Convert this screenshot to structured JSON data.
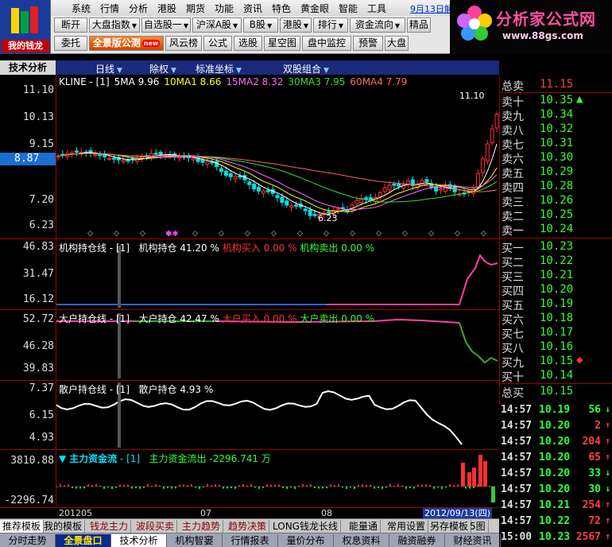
{
  "app": {
    "logo_text": "我的钱龙",
    "brand_title": "分析家公式网",
    "brand_url": "www.88gs.com"
  },
  "menu": [
    "系统",
    "行情",
    "分析",
    "港股",
    "期货",
    "功能",
    "资讯",
    "特色",
    "黄金眼",
    "智能",
    "工具"
  ],
  "menu_date": "9月13日解",
  "toolbar": {
    "row1": [
      {
        "label": "断开",
        "dd": false
      },
      {
        "label": "大盘指数",
        "dd": true
      },
      {
        "label": "自选股一",
        "dd": true
      },
      {
        "label": "沪深A股",
        "dd": true
      },
      {
        "label": "B股",
        "dd": true
      },
      {
        "label": "港股",
        "dd": true
      },
      {
        "label": "排行",
        "dd": true
      },
      {
        "label": "资金流向",
        "dd": true
      },
      {
        "label": "精品",
        "dd": false
      }
    ],
    "row2": [
      {
        "label": "委托",
        "dd": false
      },
      {
        "label": "全景版公测",
        "dd": false,
        "badge": "new"
      },
      {
        "label": "风云榜",
        "dd": false
      },
      {
        "label": "公式",
        "dd": false
      },
      {
        "label": "选股",
        "dd": false
      },
      {
        "label": "星空图",
        "dd": false
      },
      {
        "label": "盘中监控",
        "dd": false
      },
      {
        "label": "预警",
        "dd": false
      },
      {
        "label": "大盘",
        "dd": false
      }
    ]
  },
  "header": {
    "tab": "技术分析",
    "selectors": [
      "日线",
      "除权",
      "标准坐标",
      "双股组合"
    ]
  },
  "kline": {
    "legend_name": "KLINE",
    "legend_period": "[1]",
    "ma": [
      {
        "label": "5MA",
        "value": "9.96",
        "color": "#ffffff"
      },
      {
        "label": "10MA1",
        "value": "8.66",
        "color": "#ffff00"
      },
      {
        "label": "15MA2",
        "value": "8.32",
        "color": "#ff66ff"
      },
      {
        "label": "30MA3",
        "value": "7.95",
        "color": "#33dd33"
      },
      {
        "label": "60MA4",
        "value": "7.79",
        "color": "#ff6666"
      }
    ],
    "y_labels": [
      "11.10",
      "10.13",
      "9.15",
      "7.20",
      "6.23"
    ],
    "current_price": "8.87",
    "high_label": "11.10",
    "low_label": "6.23"
  },
  "inst": {
    "name": "机构持仓线",
    "period": "[1]",
    "hold_label": "机构持仓",
    "hold": "41.20 %",
    "buy_label": "机构买入",
    "buy": "0.00 %",
    "sell_label": "机构卖出",
    "sell": "0.00 %",
    "y_labels": [
      "46.83",
      "31.47",
      "16.12"
    ]
  },
  "big": {
    "name": "大户持仓线",
    "period": "[1]",
    "hold_label": "大户持仓",
    "hold": "42.47 %",
    "buy_label": "大户买入",
    "buy": "0.00 %",
    "sell_label": "大户卖出",
    "sell": "0.00 %",
    "y_labels": [
      "52.72",
      "46.28",
      "39.83"
    ]
  },
  "retail": {
    "name": "散户持仓线",
    "period": "[1]",
    "hold_label": "散户持仓",
    "hold": "4.93 %",
    "y_labels": [
      "7.37",
      "6.15",
      "4.93"
    ]
  },
  "flow": {
    "name": "主力资金流",
    "period": "[1]",
    "label": "主力资金流出",
    "value": "-2296.741 万",
    "y_labels": [
      "3810.88",
      "-2296.74"
    ]
  },
  "x_axis": {
    "labels": [
      "201205",
      "07",
      "08"
    ],
    "current": "2012/09/13(四)"
  },
  "book": {
    "sell_total": {
      "label": "总卖",
      "price": "11.15"
    },
    "sells": [
      {
        "label": "卖十",
        "price": "10.35",
        "mark": "▲"
      },
      {
        "label": "卖九",
        "price": "10.34"
      },
      {
        "label": "卖八",
        "price": "10.32"
      },
      {
        "label": "卖七",
        "price": "10.31"
      },
      {
        "label": "卖六",
        "price": "10.30"
      },
      {
        "label": "卖五",
        "price": "10.29"
      },
      {
        "label": "卖四",
        "price": "10.28"
      },
      {
        "label": "卖三",
        "price": "10.26"
      },
      {
        "label": "卖二",
        "price": "10.25"
      },
      {
        "label": "卖一",
        "price": "10.24"
      }
    ],
    "buys": [
      {
        "label": "买一",
        "price": "10.23"
      },
      {
        "label": "买二",
        "price": "10.22"
      },
      {
        "label": "买三",
        "price": "10.21"
      },
      {
        "label": "买四",
        "price": "10.20"
      },
      {
        "label": "买五",
        "price": "10.19"
      },
      {
        "label": "买六",
        "price": "10.18"
      },
      {
        "label": "买七",
        "price": "10.17"
      },
      {
        "label": "买八",
        "price": "10.16"
      },
      {
        "label": "买九",
        "price": "10.15",
        "mark": "◆"
      },
      {
        "label": "买十",
        "price": "10.14"
      }
    ],
    "buy_total": {
      "label": "总买",
      "price": "10.15"
    }
  },
  "ticks": [
    {
      "time": "14:57",
      "price": "10.19",
      "vol": "56",
      "dir": "↓"
    },
    {
      "time": "14:57",
      "price": "10.20",
      "vol": "2",
      "dir": "↑"
    },
    {
      "time": "14:57",
      "price": "10.20",
      "vol": "204",
      "dir": "↑"
    },
    {
      "time": "14:57",
      "price": "10.20",
      "vol": "65",
      "dir": "↑"
    },
    {
      "time": "14:57",
      "price": "10.20",
      "vol": "33",
      "dir": "↓"
    },
    {
      "time": "14:57",
      "price": "10.20",
      "vol": "30",
      "dir": "↓"
    },
    {
      "time": "14:57",
      "price": "10.21",
      "vol": "254",
      "dir": "↑"
    },
    {
      "time": "14:57",
      "price": "10.22",
      "vol": "72",
      "dir": "↑"
    },
    {
      "time": "15:00",
      "price": "10.23",
      "vol": "2567",
      "dir": "↑"
    }
  ],
  "tabs1": [
    "推荐模板",
    "我的模板",
    "钱龙主力",
    "波段买卖",
    "主力趋势",
    "趋势决策",
    "LONG钱龙长线",
    "能量通",
    "常用设置",
    "另存模板",
    "5图"
  ],
  "tabs2": [
    "分时走势",
    "全景盘口",
    "技术分析",
    "机构智窭",
    "行情报表",
    "量价分布",
    "权息资料",
    "融资融券",
    "财经资讯"
  ],
  "colors": {
    "up": "#ff3030",
    "down": "#00e0e0",
    "grid": "#a00000",
    "price_up": "#ff4040",
    "price_down": "#33ff33"
  }
}
